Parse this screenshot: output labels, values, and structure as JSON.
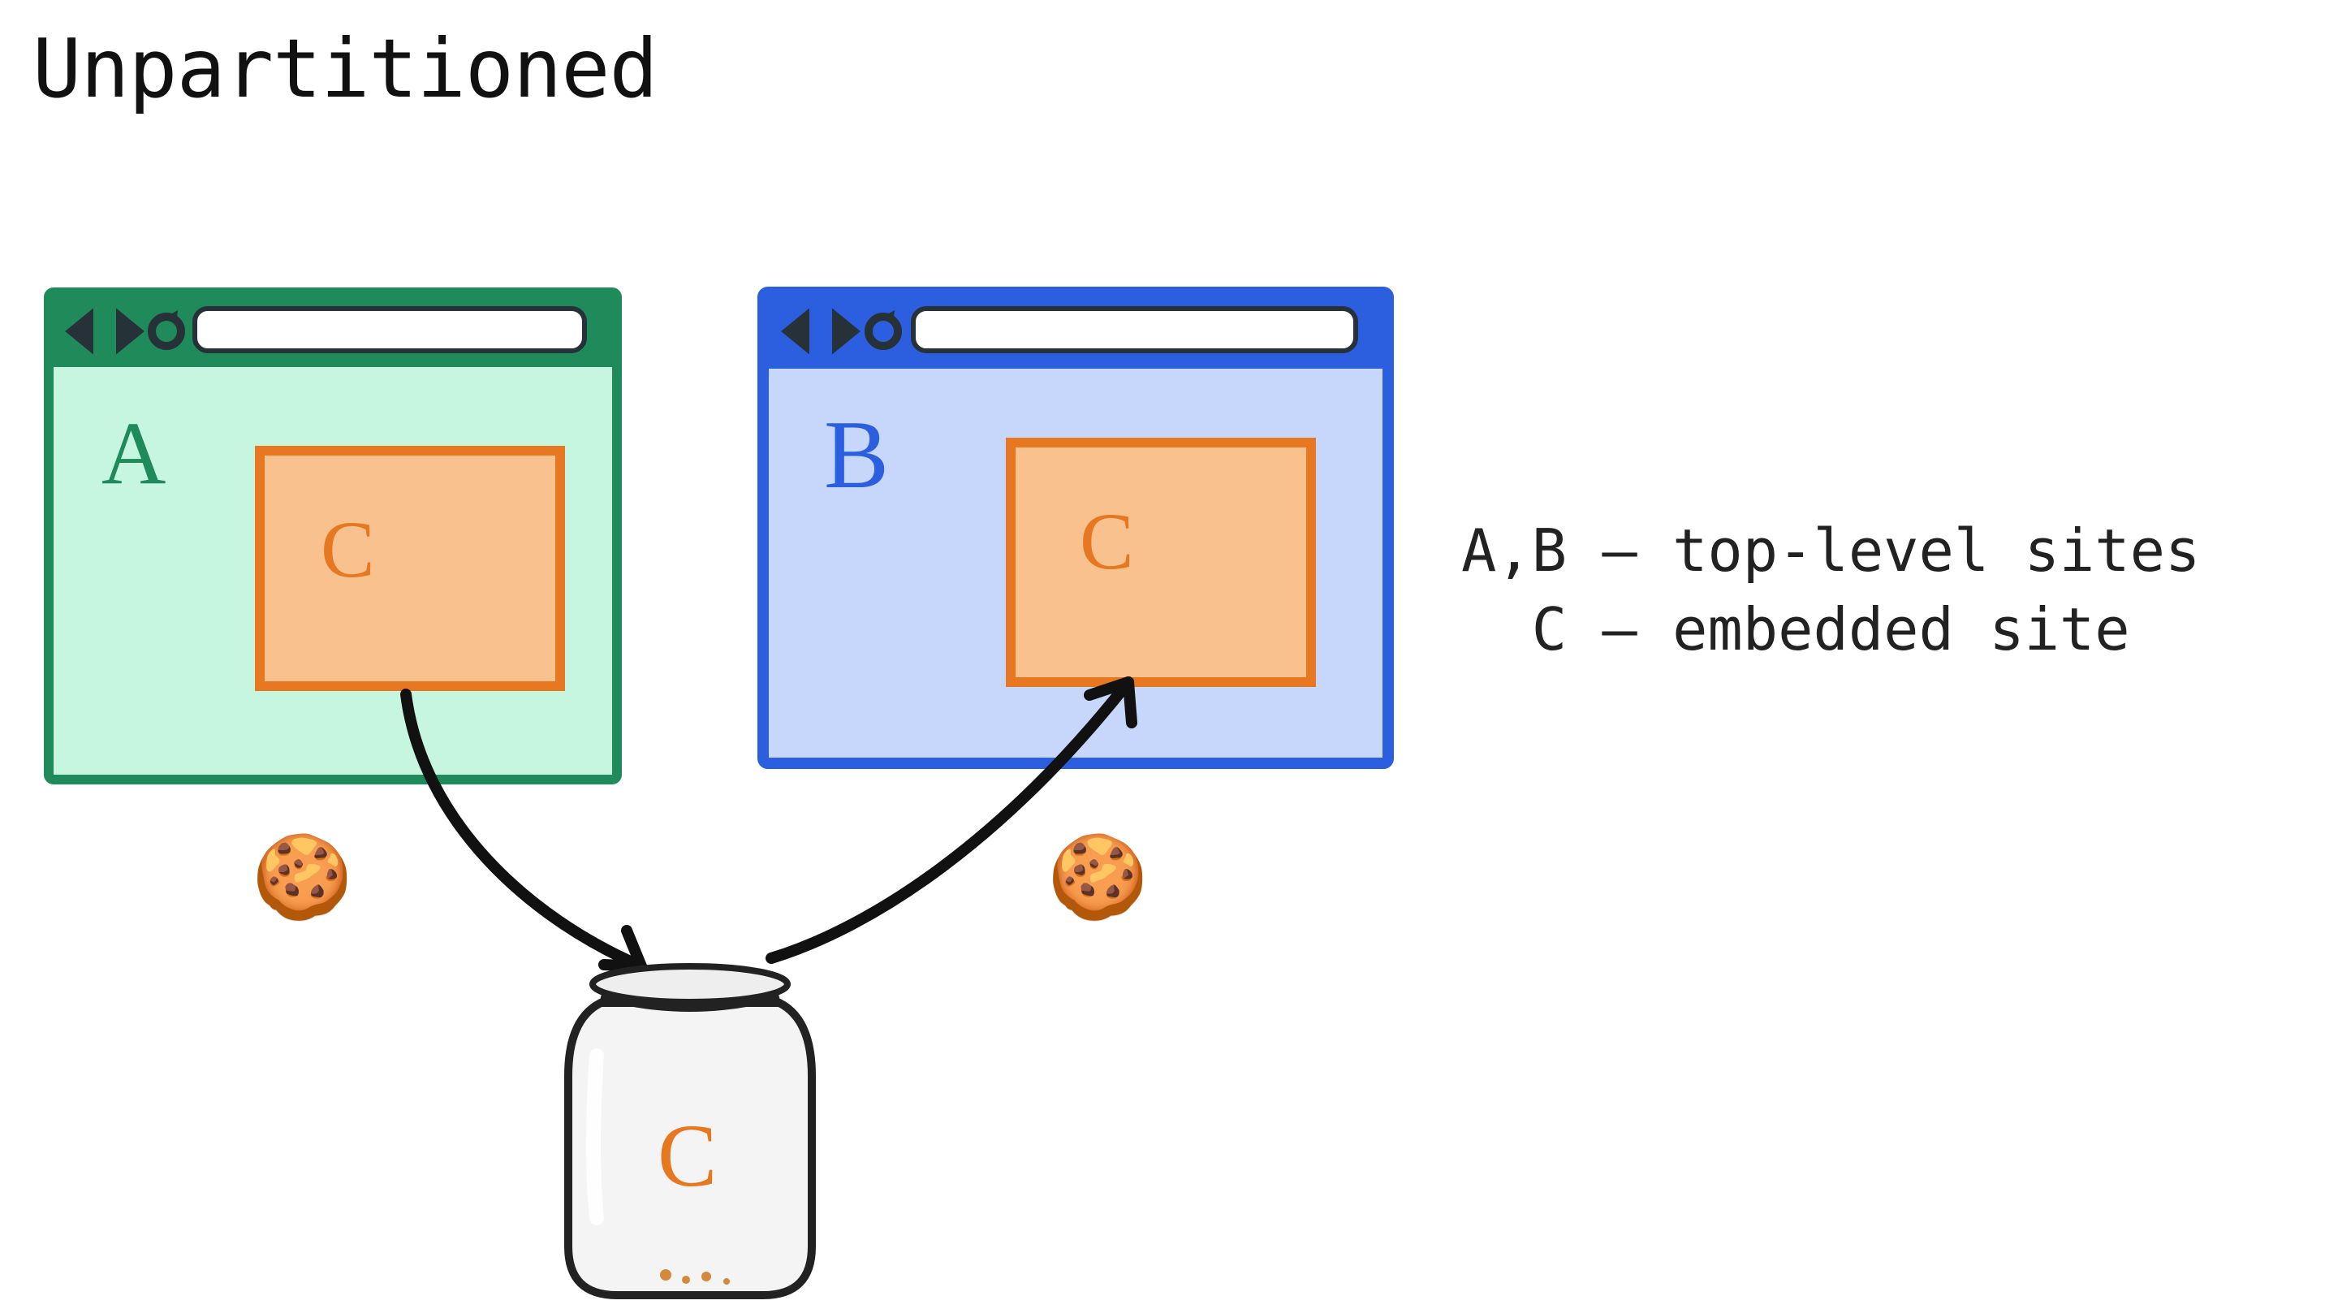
{
  "title": "Unpartitioned",
  "legend_line1": "A,B — top-level sites",
  "legend_line2": "  C — embedded site",
  "browsers": {
    "a": {
      "label": "A",
      "iframe_label": "C"
    },
    "b": {
      "label": "B",
      "iframe_label": "C"
    }
  },
  "jar": {
    "label": "C"
  },
  "colors": {
    "green_stroke": "#1f8a5a",
    "green_fill": "#c6f5e0",
    "blue_stroke": "#2b5fe0",
    "blue_fill": "#c7d7fb",
    "orange_stroke": "#e87722",
    "orange_fill": "#f8c18d",
    "arrow": "#111111"
  },
  "icons": {
    "cookie": "🍪"
  }
}
